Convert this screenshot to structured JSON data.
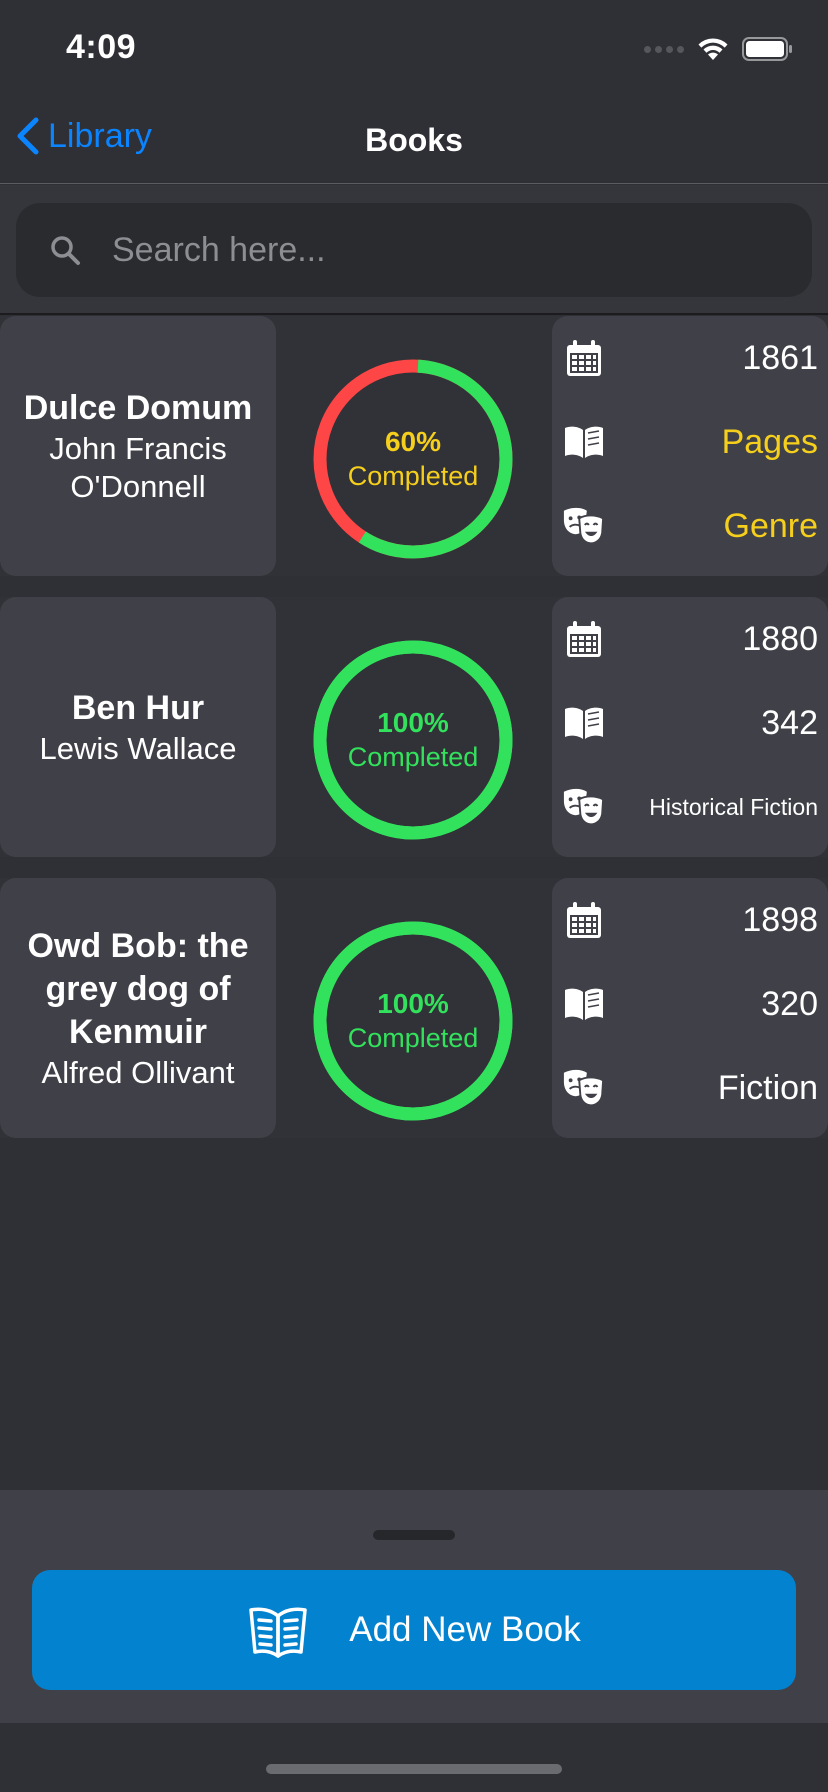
{
  "status_bar": {
    "time": "4:09"
  },
  "nav": {
    "back_label": "Library",
    "title": "Books"
  },
  "search": {
    "placeholder": "Search here..."
  },
  "colors": {
    "accent_blue": "#0a84ff",
    "progress_green": "#32e25c",
    "progress_red": "#ff4646",
    "progress_yellow": "#f5cf1c",
    "button_blue": "#0282cf"
  },
  "books": [
    {
      "title": "Dulce Domum",
      "author": "John Francis O'Donnell",
      "progress_percent": 60,
      "progress_label": "60%",
      "progress_text": "Completed",
      "year": "1861",
      "pages": "Pages",
      "genre": "Genre"
    },
    {
      "title": "Ben Hur",
      "author": "Lewis Wallace",
      "progress_percent": 100,
      "progress_label": "100%",
      "progress_text": "Completed",
      "year": "1880",
      "pages": "342",
      "genre": "Historical Fiction"
    },
    {
      "title": "Owd Bob: the grey dog of Kenmuir",
      "author": "Alfred Ollivant",
      "progress_percent": 100,
      "progress_label": "100%",
      "progress_text": "Completed",
      "year": "1898",
      "pages": "320",
      "genre": "Fiction"
    }
  ],
  "icons": {
    "year": "calendar-icon",
    "pages": "open-book-icon",
    "genre": "theater-masks-icon",
    "add": "open-book-icon"
  },
  "actions": {
    "add_book_label": "Add New Book"
  }
}
